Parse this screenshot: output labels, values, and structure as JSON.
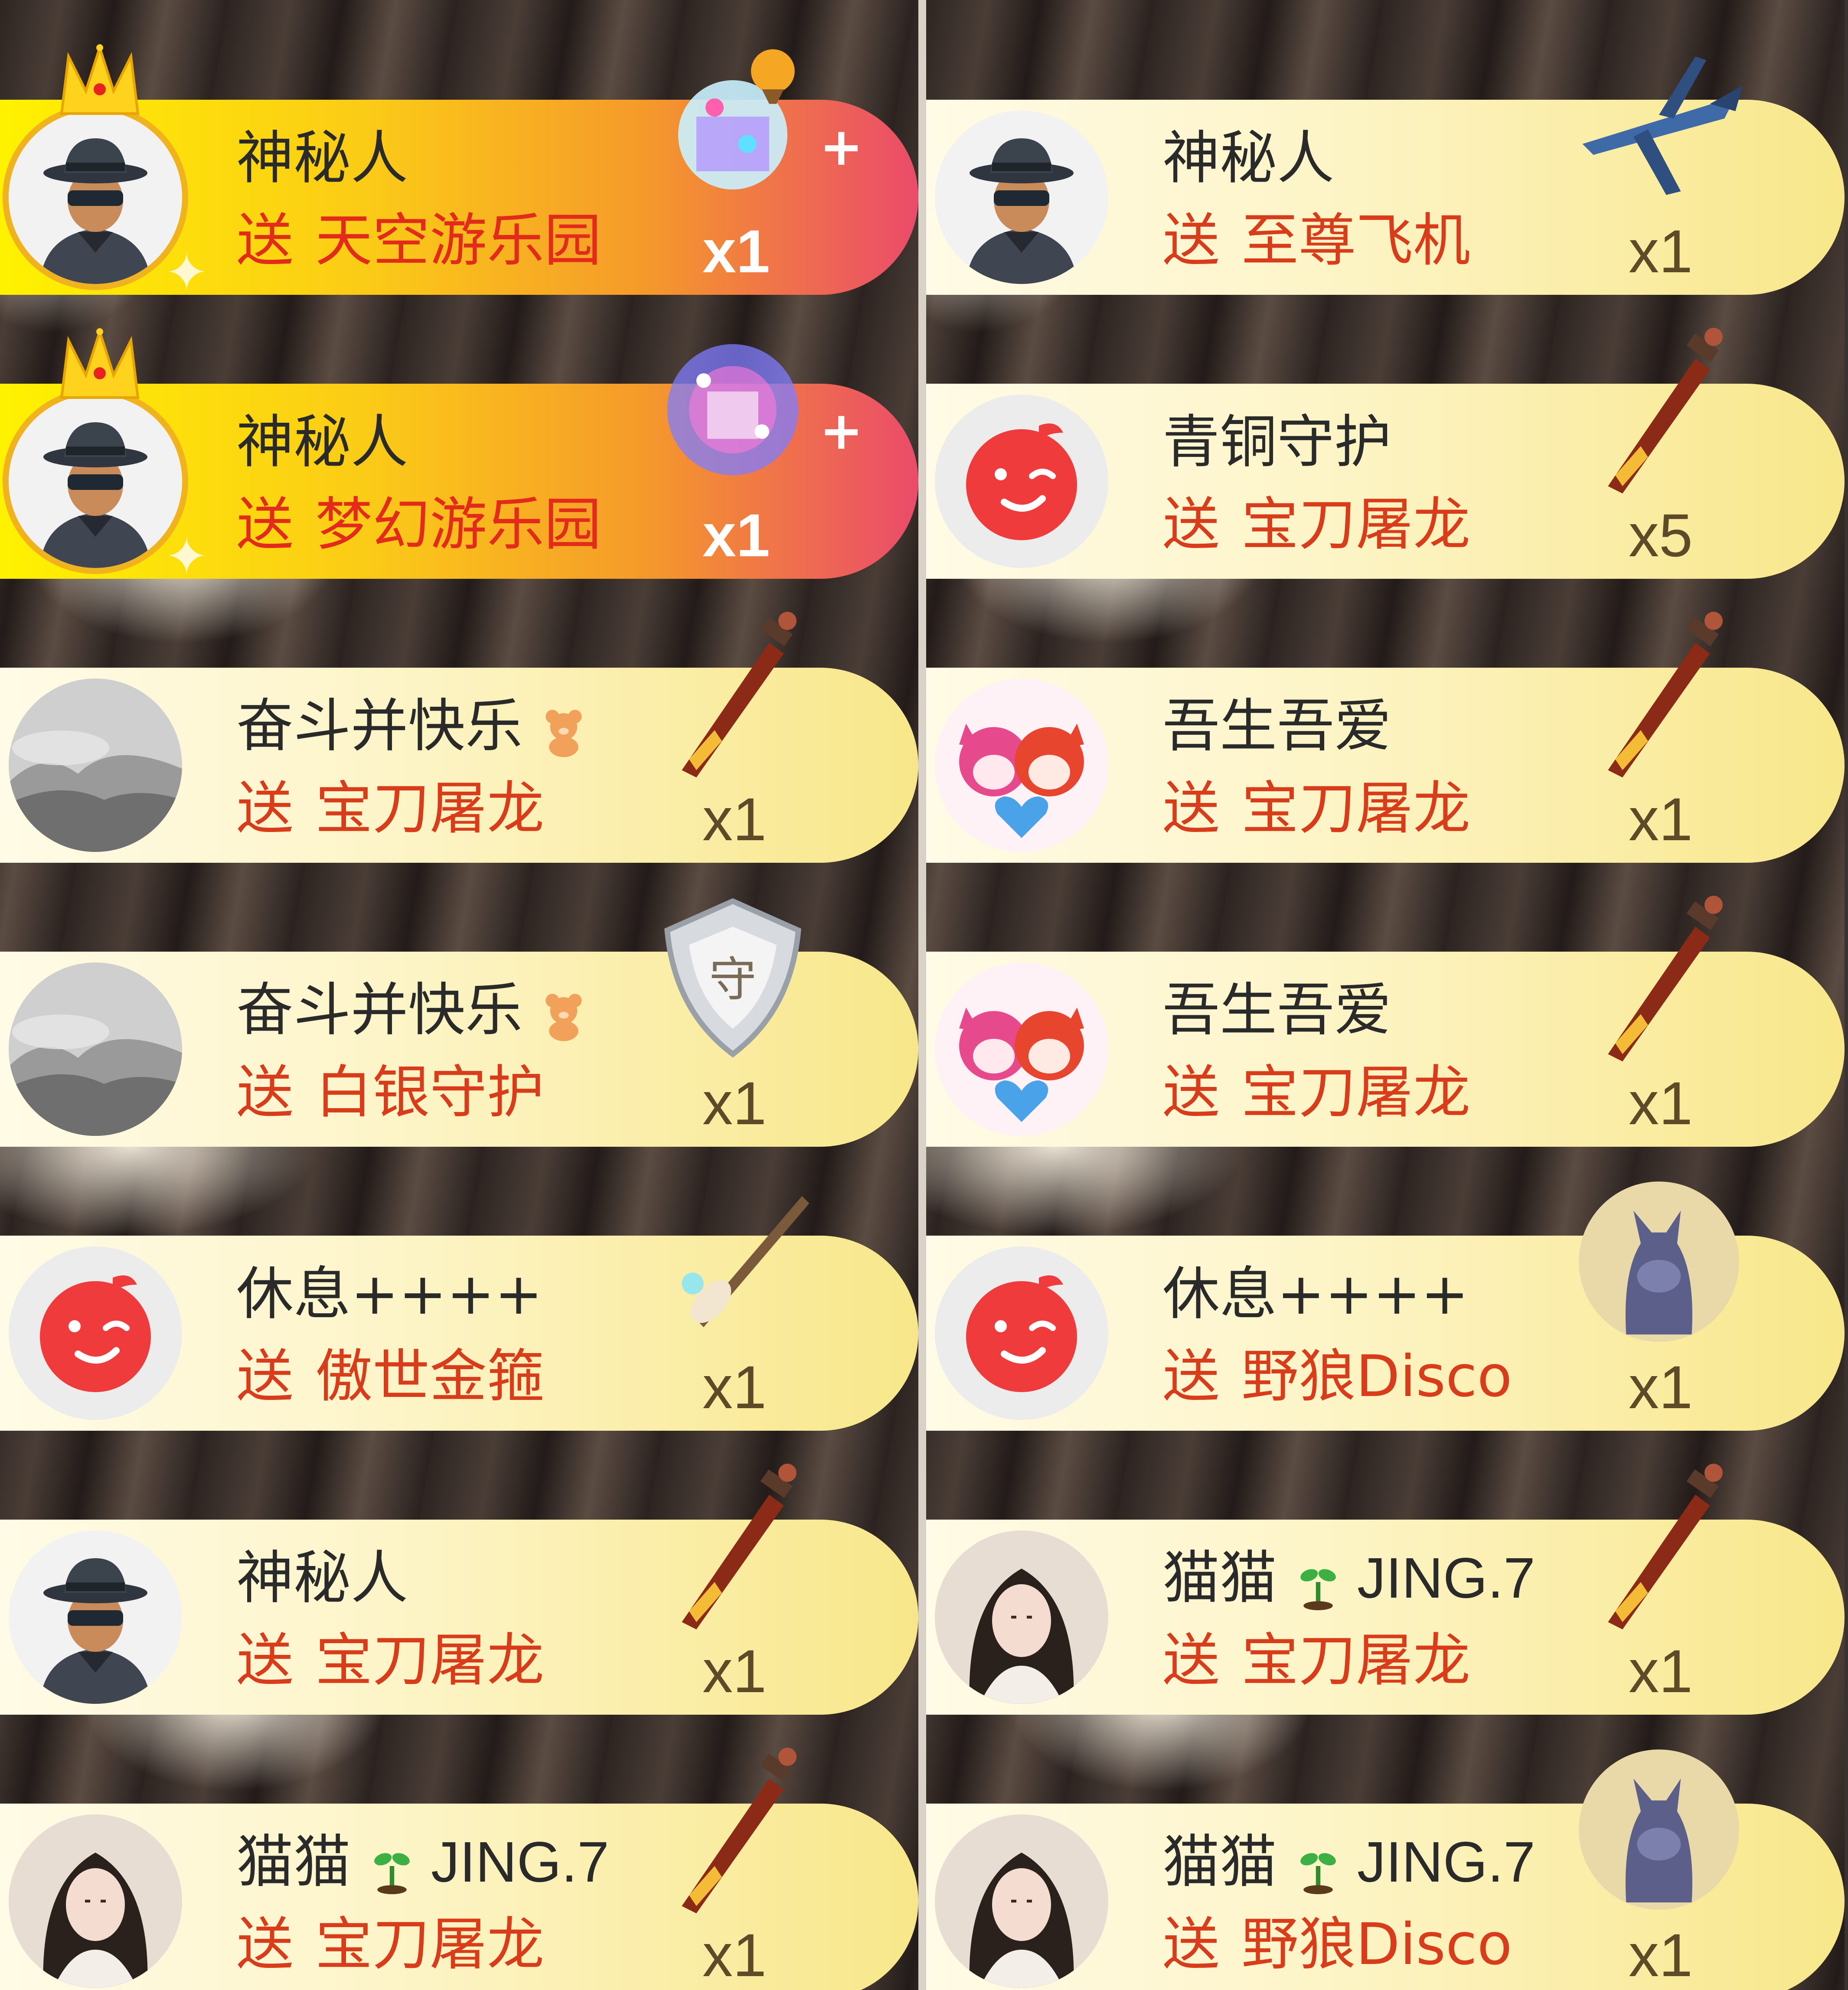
{
  "columns": [
    {
      "entries": [
        {
          "user": "神秘人",
          "badge": "",
          "suffix": "",
          "verb": "送",
          "gift": "天空游乐园",
          "count": "x1",
          "avatar": "mystery-man",
          "gift_icon": "sky-amusement-park",
          "premium": true
        },
        {
          "user": "神秘人",
          "badge": "",
          "suffix": "",
          "verb": "送",
          "gift": "梦幻游乐园",
          "count": "x1",
          "avatar": "mystery-man",
          "gift_icon": "dream-amusement-park",
          "premium": true
        },
        {
          "user": "奋斗并快乐",
          "badge": "bear",
          "suffix": "",
          "verb": "送",
          "gift": "宝刀屠龙",
          "count": "x1",
          "avatar": "landscape",
          "gift_icon": "dragon-sword",
          "premium": false
        },
        {
          "user": "奋斗并快乐",
          "badge": "bear",
          "suffix": "",
          "verb": "送",
          "gift": "白银守护",
          "count": "x1",
          "avatar": "landscape",
          "gift_icon": "silver-shield",
          "premium": false
        },
        {
          "user": "休息++++",
          "badge": "",
          "suffix": "",
          "verb": "送",
          "gift": "傲世金箍",
          "count": "x1",
          "avatar": "red-wink",
          "gift_icon": "golden-staff",
          "premium": false
        },
        {
          "user": "神秘人",
          "badge": "",
          "suffix": "",
          "verb": "送",
          "gift": "宝刀屠龙",
          "count": "x1",
          "avatar": "mystery-man",
          "gift_icon": "dragon-sword",
          "premium": false
        },
        {
          "user": "猫猫",
          "badge": "sprout",
          "suffix": "JING.7",
          "verb": "送",
          "gift": "宝刀屠龙",
          "count": "x1",
          "avatar": "girl-photo",
          "gift_icon": "dragon-sword",
          "premium": false
        }
      ]
    },
    {
      "entries": [
        {
          "user": "神秘人",
          "badge": "",
          "suffix": "",
          "verb": "送",
          "gift": "至尊飞机",
          "count": "x1",
          "avatar": "mystery-man",
          "gift_icon": "supreme-plane",
          "premium": false
        },
        {
          "user": "青铜守护",
          "badge": "",
          "suffix": "",
          "verb": "送",
          "gift": "宝刀屠龙",
          "count": "x5",
          "avatar": "red-wink",
          "gift_icon": "dragon-sword",
          "premium": false
        },
        {
          "user": "吾生吾爱",
          "badge": "",
          "suffix": "",
          "verb": "送",
          "gift": "宝刀屠龙",
          "count": "x1",
          "avatar": "cartoon-foxes",
          "gift_icon": "dragon-sword",
          "premium": false
        },
        {
          "user": "吾生吾爱",
          "badge": "",
          "suffix": "",
          "verb": "送",
          "gift": "宝刀屠龙",
          "count": "x1",
          "avatar": "cartoon-foxes",
          "gift_icon": "dragon-sword",
          "premium": false
        },
        {
          "user": "休息++++",
          "badge": "",
          "suffix": "",
          "verb": "送",
          "gift": "野狼Disco",
          "count": "x1",
          "avatar": "red-wink",
          "gift_icon": "wolf-disco",
          "premium": false
        },
        {
          "user": "猫猫",
          "badge": "sprout",
          "suffix": "JING.7",
          "verb": "送",
          "gift": "宝刀屠龙",
          "count": "x1",
          "avatar": "girl-photo",
          "gift_icon": "dragon-sword",
          "premium": false
        },
        {
          "user": "猫猫",
          "badge": "sprout",
          "suffix": "JING.7",
          "verb": "送",
          "gift": "野狼Disco",
          "count": "x1",
          "avatar": "girl-photo",
          "gift_icon": "wolf-disco",
          "premium": false
        }
      ]
    }
  ],
  "colors": {
    "gift_text": "#d93c1a",
    "name_text": "#2a2a2a",
    "premium_start": "#fff200",
    "premium_end": "#ea4b6a",
    "normal_end": "#f8e78a"
  }
}
